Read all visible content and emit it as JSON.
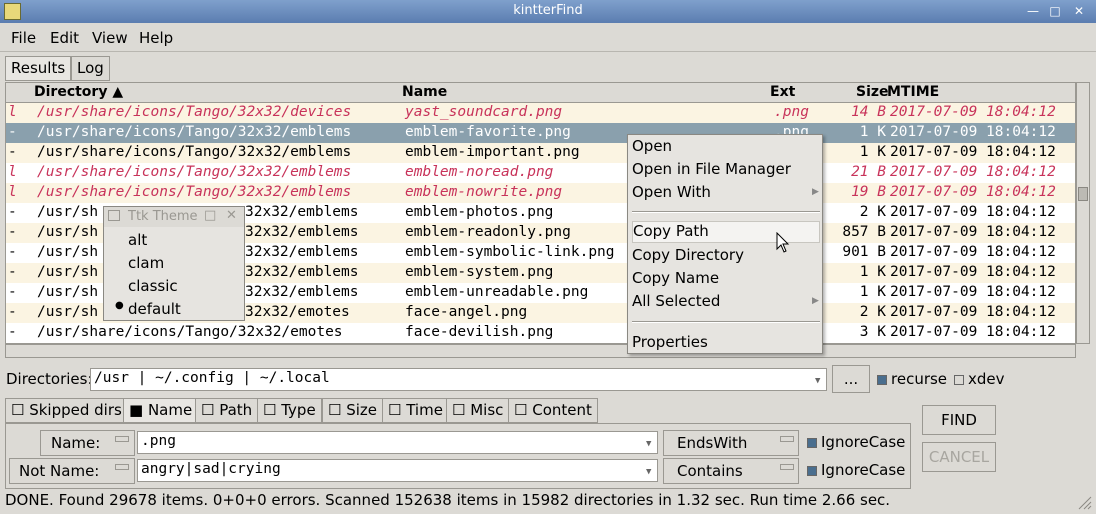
{
  "window": {
    "title": "kintterFind"
  },
  "menu": [
    "File",
    "Edit",
    "View",
    "Help"
  ],
  "top_tabs": [
    "Results",
    "Log"
  ],
  "columns": [
    "Directory ▲",
    "Name",
    "Ext",
    "Size",
    "MTIME"
  ],
  "rows": [
    {
      "flag": "l",
      "dir": "/usr/share/icons/Tango/32x32/devices",
      "name": "yast_soundcard.png",
      "ext": ".png",
      "size": "14 B",
      "mtime": "2017-07-09 18:04:12",
      "type": "link"
    },
    {
      "flag": "-",
      "dir": "/usr/share/icons/Tango/32x32/emblems",
      "name": "emblem-favorite.png",
      "ext": ".png",
      "size": "1 K",
      "mtime": "2017-07-09 18:04:12",
      "type": "sel"
    },
    {
      "flag": "-",
      "dir": "/usr/share/icons/Tango/32x32/emblems",
      "name": "emblem-important.png",
      "ext": "",
      "size": "1 K",
      "mtime": "2017-07-09 18:04:12",
      "type": "file"
    },
    {
      "flag": "l",
      "dir": "/usr/share/icons/Tango/32x32/emblems",
      "name": "emblem-noread.png",
      "ext": "",
      "size": "21 B",
      "mtime": "2017-07-09 18:04:12",
      "type": "link"
    },
    {
      "flag": "l",
      "dir": "/usr/share/icons/Tango/32x32/emblems",
      "name": "emblem-nowrite.png",
      "ext": "",
      "size": "19 B",
      "mtime": "2017-07-09 18:04:12",
      "type": "link"
    },
    {
      "flag": "-",
      "dir": "/usr/sh",
      "dir_tail": "32x32/emblems",
      "name": "emblem-photos.png",
      "ext": "",
      "size": "2 K",
      "mtime": "2017-07-09 18:04:12",
      "type": "file"
    },
    {
      "flag": "-",
      "dir": "/usr/sh",
      "dir_tail": "32x32/emblems",
      "name": "emblem-readonly.png",
      "ext": "",
      "size": "857 B",
      "mtime": "2017-07-09 18:04:12",
      "type": "file"
    },
    {
      "flag": "-",
      "dir": "/usr/sh",
      "dir_tail": "32x32/emblems",
      "name": "emblem-symbolic-link.png",
      "ext": "",
      "size": "901 B",
      "mtime": "2017-07-09 18:04:12",
      "type": "file"
    },
    {
      "flag": "-",
      "dir": "/usr/sh",
      "dir_tail": "32x32/emblems",
      "name": "emblem-system.png",
      "ext": "",
      "size": "1 K",
      "mtime": "2017-07-09 18:04:12",
      "type": "file"
    },
    {
      "flag": "-",
      "dir": "/usr/sh",
      "dir_tail": "32x32/emblems",
      "name": "emblem-unreadable.png",
      "ext": "",
      "size": "1 K",
      "mtime": "2017-07-09 18:04:12",
      "type": "file"
    },
    {
      "flag": "-",
      "dir": "/usr/sh",
      "dir_tail": "32x32/emotes",
      "name": "face-angel.png",
      "ext": "",
      "size": "2 K",
      "mtime": "2017-07-09 18:04:12",
      "type": "file"
    },
    {
      "flag": "-",
      "dir": "/usr/share/icons/Tango/32x32/emotes",
      "name": "face-devilish.png",
      "ext": "",
      "size": "3 K",
      "mtime": "2017-07-09 18:04:12",
      "type": "file"
    }
  ],
  "context_menu": {
    "items": [
      "Open",
      "Open in File Manager",
      "Open With",
      "Copy Path",
      "Copy Directory",
      "Copy Name",
      "All Selected",
      "Properties"
    ]
  },
  "theme_window": {
    "title": "Ttk Theme",
    "items": [
      "alt",
      "clam",
      "classic",
      "default"
    ],
    "selected": "default"
  },
  "directories": {
    "label": "Directories:",
    "value": "/usr | ~/.config | ~/.local",
    "browse": "...",
    "recurse": "recurse",
    "xdev": "xdev"
  },
  "filter_tabs": [
    "Skipped dirs",
    "Name",
    "Path",
    "Type",
    "Size",
    "Time",
    "Misc",
    "Content"
  ],
  "name_filter": {
    "label": "Name:",
    "value": ".png",
    "mode": "EndsWith",
    "ignorecase": "IgnoreCase"
  },
  "notname_filter": {
    "label": "Not Name:",
    "value": "angry|sad|crying",
    "mode": "Contains",
    "ignorecase": "IgnoreCase"
  },
  "buttons": {
    "find": "FIND",
    "cancel": "CANCEL"
  },
  "status": "DONE. Found 29678 items. 0+0+0 errors. Scanned 152638 items in 15982 directories in 1.32 sec. Run time 2.66 sec."
}
